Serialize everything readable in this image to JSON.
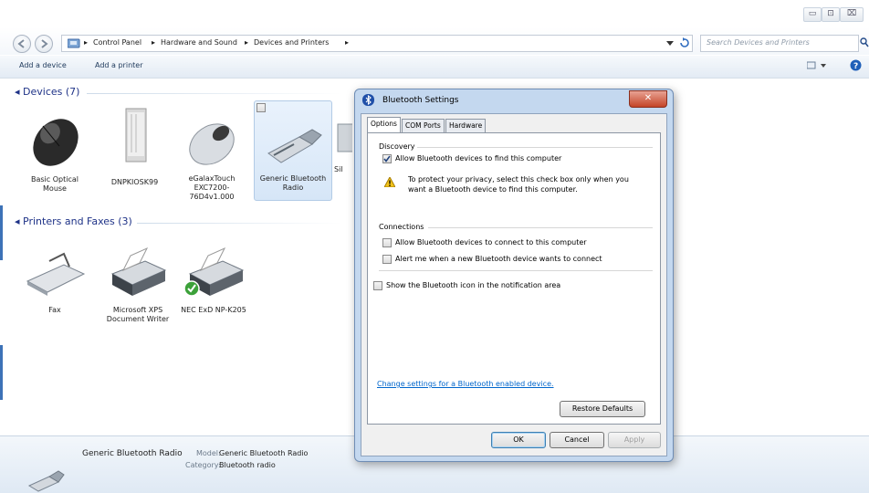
{
  "window": {
    "caption_buttons": [
      "▭",
      "⊡",
      "⌧"
    ]
  },
  "address": {
    "crumbs": [
      "Control Panel",
      "Hardware and Sound",
      "Devices and Printers"
    ],
    "search_placeholder": "Search Devices and Printers"
  },
  "toolbar": {
    "add_device": "Add a device",
    "add_printer": "Add a printer"
  },
  "devices": {
    "heading": "Devices (7)",
    "items": [
      {
        "label": "Basic Optical Mouse"
      },
      {
        "label": "DNPKIOSK99"
      },
      {
        "label": "eGalaxTouch EXC7200-76D4v1.000"
      },
      {
        "label": "Generic Bluetooth Radio"
      },
      {
        "label": "Sil"
      }
    ]
  },
  "printers": {
    "heading": "Printers and Faxes (3)",
    "items": [
      {
        "label": "Fax"
      },
      {
        "label": "Microsoft XPS Document Writer"
      },
      {
        "label": "NEC ExD NP-K205"
      }
    ]
  },
  "details": {
    "device_name": "Generic Bluetooth Radio",
    "model_label": "Model:",
    "model_value": "Generic Bluetooth Radio",
    "category_label": "Category:",
    "category_value": "Bluetooth radio"
  },
  "dialog": {
    "title": "Bluetooth Settings",
    "close": "✕",
    "tabs": [
      "Options",
      "COM Ports",
      "Hardware"
    ],
    "discovery_label": "Discovery",
    "allow_find": "Allow Bluetooth devices to find this computer",
    "privacy_note": "To protect your privacy, select this check box only when you want a Bluetooth device to find this computer.",
    "connections_label": "Connections",
    "allow_connect": "Allow Bluetooth devices to connect to this computer",
    "alert_connect": "Alert me when a new Bluetooth device wants to connect",
    "show_icon": "Show the Bluetooth icon in the notification area",
    "link": "Change settings for a Bluetooth enabled device.",
    "restore": "Restore Defaults",
    "ok": "OK",
    "cancel": "Cancel",
    "apply": "Apply"
  },
  "state": {
    "allow_find_checked": true,
    "allow_connect_checked": false,
    "alert_connect_checked": false,
    "show_icon_checked": false
  },
  "colors": {
    "group_heading": "#1e3287",
    "link": "#0066cc",
    "dialog_frame": "#c4d8ef",
    "close_button": "#c44427"
  }
}
